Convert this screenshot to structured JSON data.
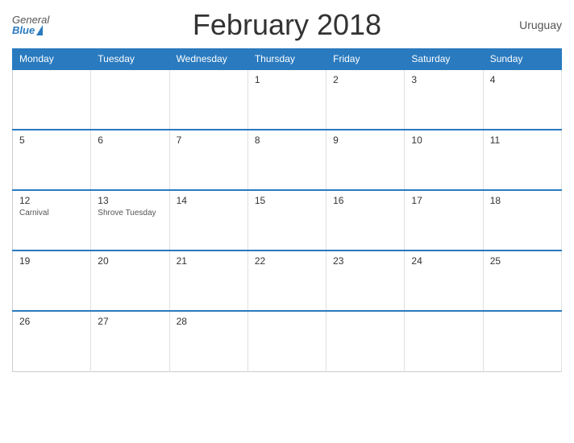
{
  "header": {
    "title": "February 2018",
    "country": "Uruguay",
    "logo_general": "General",
    "logo_blue": "Blue"
  },
  "days_of_week": [
    "Monday",
    "Tuesday",
    "Wednesday",
    "Thursday",
    "Friday",
    "Saturday",
    "Sunday"
  ],
  "weeks": [
    [
      {
        "num": "",
        "event": "",
        "empty": true
      },
      {
        "num": "",
        "event": "",
        "empty": true
      },
      {
        "num": "",
        "event": "",
        "empty": true
      },
      {
        "num": "1",
        "event": ""
      },
      {
        "num": "2",
        "event": ""
      },
      {
        "num": "3",
        "event": ""
      },
      {
        "num": "4",
        "event": ""
      }
    ],
    [
      {
        "num": "5",
        "event": ""
      },
      {
        "num": "6",
        "event": ""
      },
      {
        "num": "7",
        "event": ""
      },
      {
        "num": "8",
        "event": ""
      },
      {
        "num": "9",
        "event": ""
      },
      {
        "num": "10",
        "event": ""
      },
      {
        "num": "11",
        "event": ""
      }
    ],
    [
      {
        "num": "12",
        "event": "Carnival"
      },
      {
        "num": "13",
        "event": "Shrove Tuesday"
      },
      {
        "num": "14",
        "event": ""
      },
      {
        "num": "15",
        "event": ""
      },
      {
        "num": "16",
        "event": ""
      },
      {
        "num": "17",
        "event": ""
      },
      {
        "num": "18",
        "event": ""
      }
    ],
    [
      {
        "num": "19",
        "event": ""
      },
      {
        "num": "20",
        "event": ""
      },
      {
        "num": "21",
        "event": ""
      },
      {
        "num": "22",
        "event": ""
      },
      {
        "num": "23",
        "event": ""
      },
      {
        "num": "24",
        "event": ""
      },
      {
        "num": "25",
        "event": ""
      }
    ],
    [
      {
        "num": "26",
        "event": ""
      },
      {
        "num": "27",
        "event": ""
      },
      {
        "num": "28",
        "event": ""
      },
      {
        "num": "",
        "event": "",
        "empty": true
      },
      {
        "num": "",
        "event": "",
        "empty": true
      },
      {
        "num": "",
        "event": "",
        "empty": true
      },
      {
        "num": "",
        "event": "",
        "empty": true
      }
    ]
  ]
}
